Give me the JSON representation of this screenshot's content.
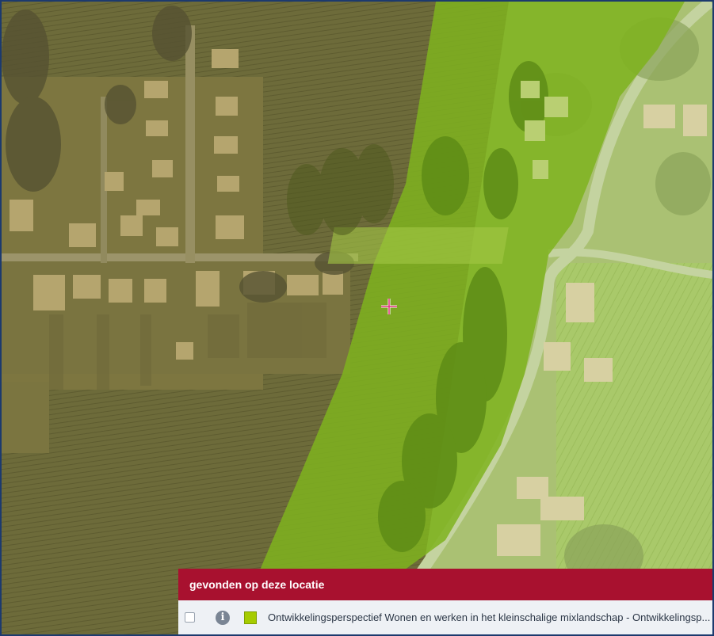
{
  "map": {
    "layer_color": "#9ccc00",
    "background": "aerial-photo"
  },
  "crosshair": {
    "icon": "crosshair-icon",
    "color": "#e0307a"
  },
  "panel": {
    "title": "gevonden op deze locatie",
    "header_color": "#a8112f",
    "results": [
      {
        "checked": false,
        "info_icon": "info-icon",
        "swatch_color": "#a6cc00",
        "label": "Ontwikkelingsperspectief Wonen en werken in het kleinschalige mixlandschap - Ontwikkelingsp..."
      }
    ]
  }
}
